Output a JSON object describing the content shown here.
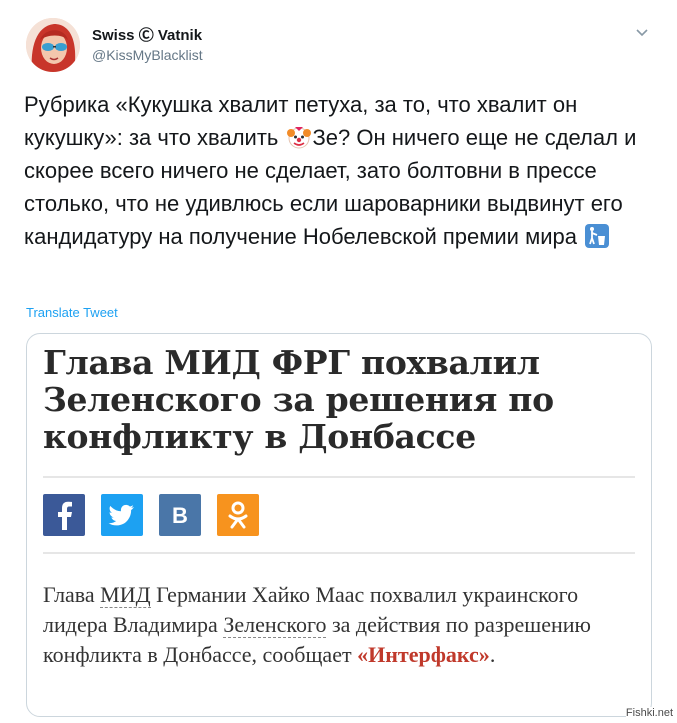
{
  "author": {
    "display_name": "Swiss Ⓒ Vatnik",
    "handle": "@KissMyBlacklist"
  },
  "tweet": {
    "text_part1": "Рубрика «Кукушка хвалит петуха, за то, что хвалит он кукушку»: за что хвалить ",
    "emoji1": "clown-face-emoji",
    "text_part2": "Зе? Он ничего еще не сделал и скорее всего ничего не сделает, зато болтовни в прессе столько, что не удивлюсь если шароварники выдвинут его кандидатуру на получение Нобелевской премии мира ",
    "emoji2": "put-litter-in-its-place-emoji",
    "translate_label": "Translate Tweet"
  },
  "card": {
    "headline": "Глава МИД ФРГ похвалил Зеленского за решения по конфликту в Донбассе",
    "share_icons": [
      "facebook-icon",
      "twitter-icon",
      "vk-icon",
      "odnoklassniki-icon"
    ],
    "body_part1": "Глава ",
    "body_link1": "МИД",
    "body_part2": " Германии Хайко Маас похвалил украинского лидера Владимира ",
    "body_link2": "Зеленского",
    "body_part3": " за действия по разрешению конфликта в Донбассе, сообщает ",
    "body_source": "«Интерфакс»",
    "body_end": "."
  },
  "colors": {
    "facebook": "#3b5998",
    "twitter": "#1da1f2",
    "vk": "#4a76a8",
    "odnoklassniki": "#f7931e",
    "link": "#1da1f2",
    "source": "#c0392b"
  },
  "watermark": "Fishki.net"
}
